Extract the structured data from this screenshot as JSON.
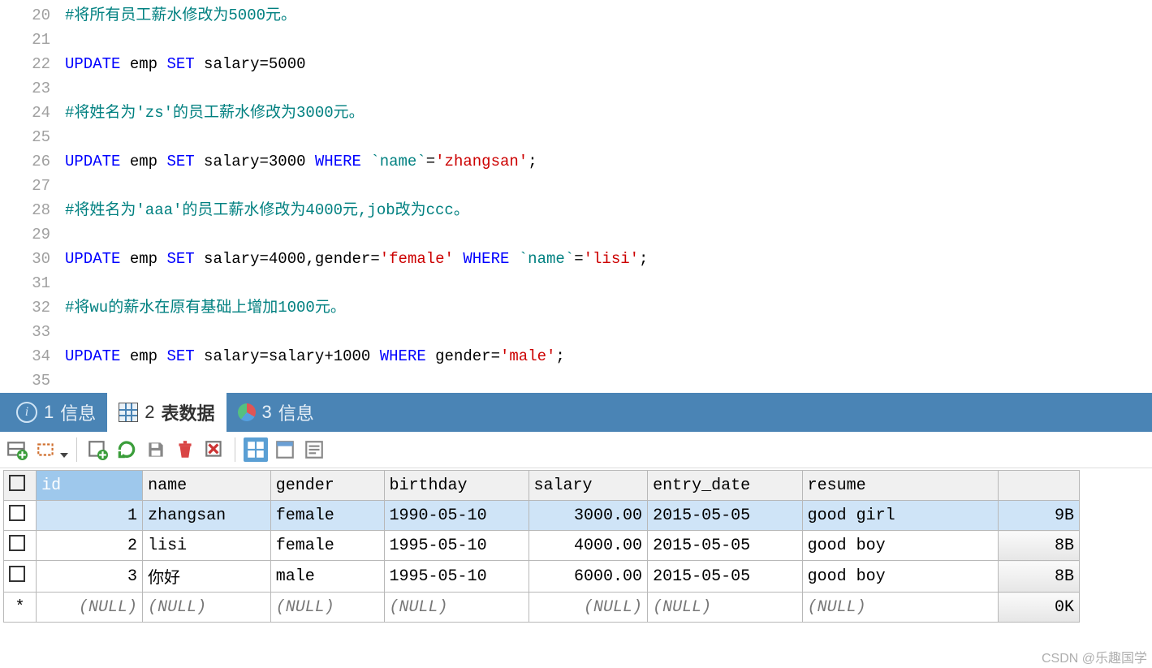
{
  "editor": {
    "lines": [
      {
        "n": 20,
        "tokens": [
          {
            "t": "c",
            "v": "#将所有员工薪水修改为5000元。"
          }
        ]
      },
      {
        "n": 21,
        "tokens": []
      },
      {
        "n": 22,
        "tokens": [
          {
            "t": "k",
            "v": "UPDATE"
          },
          {
            "t": "id",
            "v": " emp "
          },
          {
            "t": "k",
            "v": "SET"
          },
          {
            "t": "id",
            "v": " salary"
          },
          {
            "t": "sym",
            "v": "="
          },
          {
            "t": "num",
            "v": "5000"
          }
        ]
      },
      {
        "n": 23,
        "tokens": []
      },
      {
        "n": 24,
        "tokens": [
          {
            "t": "c",
            "v": "#将姓名为'zs'的员工薪水修改为3000元。"
          }
        ]
      },
      {
        "n": 25,
        "tokens": []
      },
      {
        "n": 26,
        "tokens": [
          {
            "t": "k",
            "v": "UPDATE"
          },
          {
            "t": "id",
            "v": " emp "
          },
          {
            "t": "k",
            "v": "SET"
          },
          {
            "t": "id",
            "v": " salary"
          },
          {
            "t": "sym",
            "v": "="
          },
          {
            "t": "num",
            "v": "3000 "
          },
          {
            "t": "k",
            "v": "WHERE"
          },
          {
            "t": "id",
            "v": " "
          },
          {
            "t": "bt",
            "v": "`name`"
          },
          {
            "t": "sym",
            "v": "="
          },
          {
            "t": "s",
            "v": "'zhangsan'"
          },
          {
            "t": "sym",
            "v": ";"
          }
        ]
      },
      {
        "n": 27,
        "tokens": []
      },
      {
        "n": 28,
        "tokens": [
          {
            "t": "c",
            "v": "#将姓名为'aaa'的员工薪水修改为4000元,job改为ccc。"
          }
        ]
      },
      {
        "n": 29,
        "tokens": []
      },
      {
        "n": 30,
        "tokens": [
          {
            "t": "k",
            "v": "UPDATE"
          },
          {
            "t": "id",
            "v": " emp "
          },
          {
            "t": "k",
            "v": "SET"
          },
          {
            "t": "id",
            "v": " salary"
          },
          {
            "t": "sym",
            "v": "="
          },
          {
            "t": "num",
            "v": "4000"
          },
          {
            "t": "sym",
            "v": ","
          },
          {
            "t": "id",
            "v": "gender"
          },
          {
            "t": "sym",
            "v": "="
          },
          {
            "t": "s",
            "v": "'female'"
          },
          {
            "t": "id",
            "v": " "
          },
          {
            "t": "k",
            "v": "WHERE"
          },
          {
            "t": "id",
            "v": " "
          },
          {
            "t": "bt",
            "v": "`name`"
          },
          {
            "t": "sym",
            "v": "="
          },
          {
            "t": "s",
            "v": "'lisi'"
          },
          {
            "t": "sym",
            "v": ";"
          }
        ]
      },
      {
        "n": 31,
        "tokens": []
      },
      {
        "n": 32,
        "tokens": [
          {
            "t": "c",
            "v": "#将wu的薪水在原有基础上增加1000元。"
          }
        ]
      },
      {
        "n": 33,
        "tokens": []
      },
      {
        "n": 34,
        "tokens": [
          {
            "t": "k",
            "v": "UPDATE"
          },
          {
            "t": "id",
            "v": " emp "
          },
          {
            "t": "k",
            "v": "SET"
          },
          {
            "t": "id",
            "v": " salary"
          },
          {
            "t": "sym",
            "v": "="
          },
          {
            "t": "id",
            "v": "salary"
          },
          {
            "t": "sym",
            "v": "+"
          },
          {
            "t": "num",
            "v": "1000 "
          },
          {
            "t": "k",
            "v": "WHERE"
          },
          {
            "t": "id",
            "v": " gender"
          },
          {
            "t": "sym",
            "v": "="
          },
          {
            "t": "s",
            "v": "'male'"
          },
          {
            "t": "sym",
            "v": ";"
          }
        ]
      },
      {
        "n": 35,
        "tokens": []
      }
    ]
  },
  "tabs": {
    "items": [
      {
        "num": "1",
        "label": "信息"
      },
      {
        "num": "2",
        "label": "表数据"
      },
      {
        "num": "3",
        "label": "信息"
      }
    ]
  },
  "table": {
    "columns": [
      "id",
      "name",
      "gender",
      "birthday",
      "salary",
      "entry_date",
      "resume"
    ],
    "rows": [
      {
        "id": "1",
        "name": "zhangsan",
        "gender": "female",
        "birthday": "1990-05-10",
        "salary": "3000.00",
        "entry_date": "2015-05-05",
        "resume": "good girl",
        "size": "9B"
      },
      {
        "id": "2",
        "name": "lisi",
        "gender": "female",
        "birthday": "1995-05-10",
        "salary": "4000.00",
        "entry_date": "2015-05-05",
        "resume": "good boy",
        "size": "8B"
      },
      {
        "id": "3",
        "name": "你好",
        "gender": "male",
        "birthday": "1995-05-10",
        "salary": "6000.00",
        "entry_date": "2015-05-05",
        "resume": "good boy",
        "size": "8B"
      }
    ],
    "null_text": "(NULL)",
    "null_size": "0K",
    "new_row_marker": "*"
  },
  "watermark": "CSDN @乐趣国学"
}
